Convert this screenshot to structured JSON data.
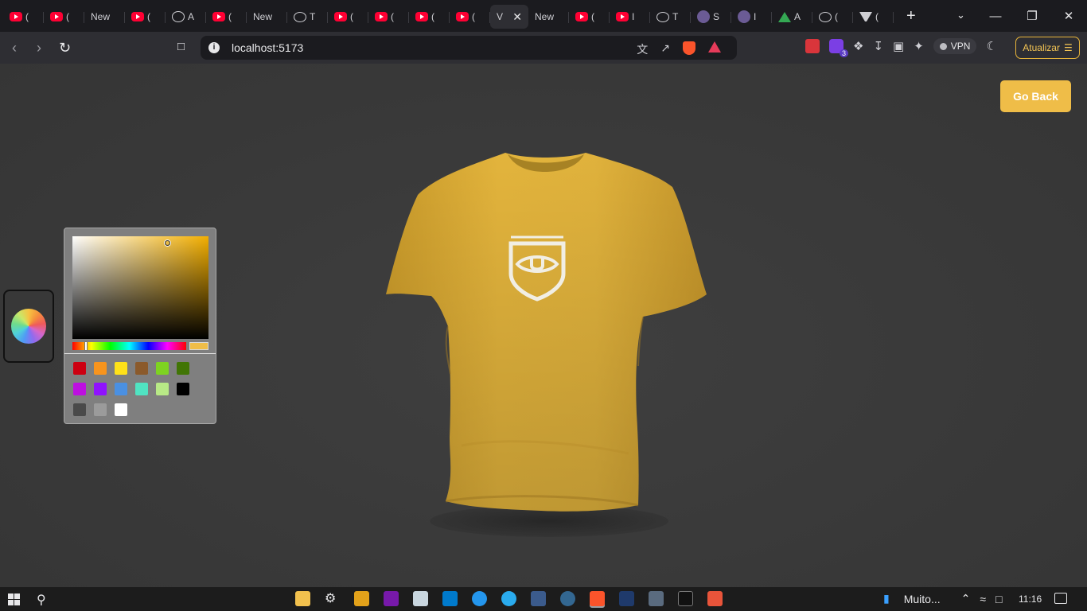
{
  "browser": {
    "tabs": [
      {
        "favicon": "youtube-icon",
        "label": "("
      },
      {
        "favicon": "youtube-icon",
        "label": "("
      },
      {
        "favicon": "",
        "label": "New"
      },
      {
        "favicon": "youtube-icon",
        "label": "("
      },
      {
        "favicon": "globe-icon",
        "label": "A"
      },
      {
        "favicon": "youtube-icon",
        "label": "("
      },
      {
        "favicon": "",
        "label": "New"
      },
      {
        "favicon": "chatgpt-icon",
        "label": "T"
      },
      {
        "favicon": "youtube-icon",
        "label": "("
      },
      {
        "favicon": "youtube-icon",
        "label": "("
      },
      {
        "favicon": "youtube-icon",
        "label": "("
      },
      {
        "favicon": "youtube-icon",
        "label": "("
      },
      {
        "favicon": "",
        "label": "V",
        "active": true
      },
      {
        "favicon": "",
        "label": "New"
      },
      {
        "favicon": "youtube-icon",
        "label": "("
      },
      {
        "favicon": "youtube-icon",
        "label": "I"
      },
      {
        "favicon": "chatgpt-icon",
        "label": "T"
      },
      {
        "favicon": "avatar-icon",
        "label": "S"
      },
      {
        "favicon": "app-icon",
        "label": "I"
      },
      {
        "favicon": "drive-icon",
        "label": "A"
      },
      {
        "favicon": "chatgpt-icon",
        "label": "("
      },
      {
        "favicon": "triangle-icon",
        "label": "("
      }
    ],
    "address": "localhost:5173",
    "vpn_label": "VPN",
    "update_label": "Atualizar",
    "extension_badge": "3"
  },
  "page": {
    "go_back_label": "Go Back",
    "selected_color": "#EFBD48",
    "shirt_color": "#E3B43C",
    "swatches": [
      "#CC0011",
      "#F7941D",
      "#FFE119",
      "#8B5A2B",
      "#7ED321",
      "#417505",
      "#BD10E0",
      "#9013FE",
      "#4A90E2",
      "#50E3C2",
      "#B8E986",
      "#000000",
      "#4A4A4A",
      "#9B9B9B",
      "#FFFFFF"
    ]
  },
  "taskbar": {
    "weather_label": "Muito...",
    "time": "11:16"
  }
}
